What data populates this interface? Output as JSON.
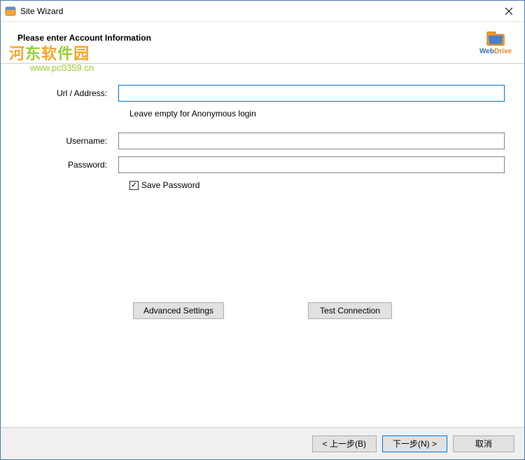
{
  "window": {
    "title": "Site Wizard"
  },
  "header": {
    "heading": "Please enter Account Information",
    "logo_web": "Web",
    "logo_drive": "Drive"
  },
  "watermark": {
    "line1": "河东软件园",
    "line2": "www.pc0359.cn"
  },
  "form": {
    "url_label": "Url / Address:",
    "url_value": "",
    "url_hint": "Leave empty for Anonymous login",
    "username_label": "Username:",
    "username_value": "",
    "password_label": "Password:",
    "password_value": "",
    "save_password_label": "Save Password",
    "save_password_checked": true
  },
  "buttons": {
    "advanced": "Advanced Settings",
    "test": "Test Connection"
  },
  "footer": {
    "back": "< 上一步(B)",
    "next": "下一步(N) >",
    "cancel": "取消"
  }
}
